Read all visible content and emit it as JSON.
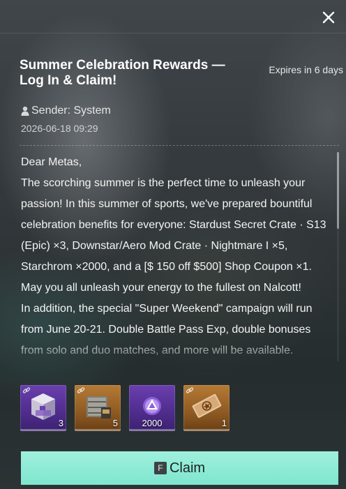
{
  "mail": {
    "title": "Summer Celebration Rewards — Log In & Claim!",
    "expires": "Expires in 6 days",
    "sender": "Sender: System",
    "date": "2026-06-18 09:29",
    "body": [
      "Dear Metas,",
      "The scorching summer is the perfect time to unleash your passion! In this summer of sports, we've prepared bountiful celebration benefits for everyone: Stardust Secret Crate · S13 (Epic) ×3, Downstar/Aero Mod Crate · Nightmare I ×5, Starchrom ×2000, and a [$ 150 off $500] Shop Coupon ×1. May you all unleash your energy to the fullest on Nalcott!",
      " In addition, the special \"Super Weekend\" campaign will run from June 20-21. Double Battle Pass Exp, double bonuses from solo and duo matches, and more will be available."
    ]
  },
  "rewards": [
    {
      "qty": "3",
      "icon": "purple-crate-icon",
      "bound": true
    },
    {
      "qty": "5",
      "icon": "gold-crate-icon",
      "bound": true
    },
    {
      "qty": "2000",
      "icon": "starchrom-icon",
      "bound": false
    },
    {
      "qty": "1",
      "icon": "coupon-icon",
      "bound": true
    }
  ],
  "claim": {
    "key": "F",
    "label": "Claim"
  },
  "colors": {
    "accent": "#8ceBd4",
    "epic": "#5e37a0",
    "legendary": "#a0692b"
  }
}
